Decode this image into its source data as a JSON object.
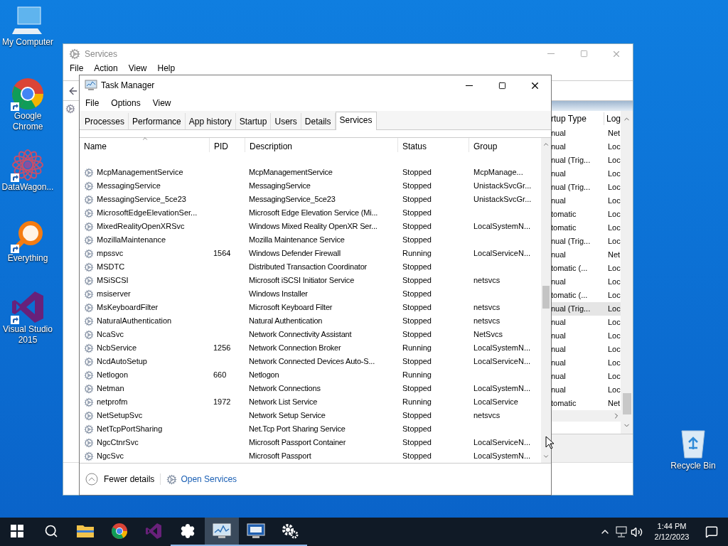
{
  "desktop_icons": [
    {
      "kind": "computer",
      "label": "My Computer",
      "shortcut": false
    },
    {
      "kind": "chrome",
      "label": "Google Chrome",
      "shortcut": true
    },
    {
      "kind": "datawagon",
      "label": "DataWagon...",
      "shortcut": true
    },
    {
      "kind": "everything",
      "label": "Everything",
      "shortcut": true
    },
    {
      "kind": "visual-studio",
      "label": "Visual Studio 2015",
      "shortcut": true
    }
  ],
  "recycle_bin": {
    "label": "Recycle Bin"
  },
  "services_window": {
    "title": "Services",
    "menu": [
      "File",
      "Action",
      "View",
      "Help"
    ],
    "columns": [
      "rtup Type",
      "Log"
    ],
    "rows": [
      {
        "startup_type": "nual",
        "log_on_as": "Net",
        "selected": false
      },
      {
        "startup_type": "nual",
        "log_on_as": "Loc",
        "selected": false
      },
      {
        "startup_type": "nual (Trig...",
        "log_on_as": "Loc",
        "selected": false
      },
      {
        "startup_type": "nual",
        "log_on_as": "Loc",
        "selected": false
      },
      {
        "startup_type": "nual (Trig...",
        "log_on_as": "Loc",
        "selected": false
      },
      {
        "startup_type": "nual",
        "log_on_as": "Loc",
        "selected": false
      },
      {
        "startup_type": "tomatic",
        "log_on_as": "Loc",
        "selected": false
      },
      {
        "startup_type": "tomatic",
        "log_on_as": "Loc",
        "selected": false
      },
      {
        "startup_type": "nual (Trig...",
        "log_on_as": "Loc",
        "selected": false
      },
      {
        "startup_type": "nual",
        "log_on_as": "Net",
        "selected": false
      },
      {
        "startup_type": "tomatic (...",
        "log_on_as": "Loc",
        "selected": false
      },
      {
        "startup_type": "nual",
        "log_on_as": "Loc",
        "selected": false
      },
      {
        "startup_type": "tomatic (...",
        "log_on_as": "Loc",
        "selected": false
      },
      {
        "startup_type": "nual (Trig...",
        "log_on_as": "Loc",
        "selected": true
      },
      {
        "startup_type": "nual",
        "log_on_as": "Loc",
        "selected": false
      },
      {
        "startup_type": "nual",
        "log_on_as": "Loc",
        "selected": false
      },
      {
        "startup_type": "nual",
        "log_on_as": "Loc",
        "selected": false
      },
      {
        "startup_type": "nual",
        "log_on_as": "Loc",
        "selected": false
      },
      {
        "startup_type": "nual",
        "log_on_as": "Loc",
        "selected": false
      },
      {
        "startup_type": "nual",
        "log_on_as": "Loc",
        "selected": false
      },
      {
        "startup_type": "tomatic",
        "log_on_as": "Net",
        "selected": false
      }
    ]
  },
  "task_manager": {
    "title": "Task Manager",
    "menu": [
      "File",
      "Options",
      "View"
    ],
    "tabs": [
      {
        "label": "Processes",
        "selected": false
      },
      {
        "label": "Performance",
        "selected": false
      },
      {
        "label": "App history",
        "selected": false
      },
      {
        "label": "Startup",
        "selected": false
      },
      {
        "label": "Users",
        "selected": false
      },
      {
        "label": "Details",
        "selected": false
      },
      {
        "label": "Services",
        "selected": true
      }
    ],
    "columns": [
      "Name",
      "PID",
      "Description",
      "Status",
      "Group"
    ],
    "rows": [
      {
        "name": "McpManagementService",
        "pid": "",
        "description": "McpManagementService",
        "status": "Stopped",
        "group": "McpManage..."
      },
      {
        "name": "MessagingService",
        "pid": "",
        "description": "MessagingService",
        "status": "Stopped",
        "group": "UnistackSvcGr..."
      },
      {
        "name": "MessagingService_5ce23",
        "pid": "",
        "description": "MessagingService_5ce23",
        "status": "Stopped",
        "group": "UnistackSvcGr..."
      },
      {
        "name": "MicrosoftEdgeElevationSer...",
        "pid": "",
        "description": "Microsoft Edge Elevation Service (Mi...",
        "status": "Stopped",
        "group": ""
      },
      {
        "name": "MixedRealityOpenXRSvc",
        "pid": "",
        "description": "Windows Mixed Reality OpenXR Ser...",
        "status": "Stopped",
        "group": "LocalSystemN..."
      },
      {
        "name": "MozillaMaintenance",
        "pid": "",
        "description": "Mozilla Maintenance Service",
        "status": "Stopped",
        "group": ""
      },
      {
        "name": "mpssvc",
        "pid": "1564",
        "description": "Windows Defender Firewall",
        "status": "Running",
        "group": "LocalServiceN..."
      },
      {
        "name": "MSDTC",
        "pid": "",
        "description": "Distributed Transaction Coordinator",
        "status": "Stopped",
        "group": ""
      },
      {
        "name": "MSiSCSI",
        "pid": "",
        "description": "Microsoft iSCSI Initiator Service",
        "status": "Stopped",
        "group": "netsvcs"
      },
      {
        "name": "msiserver",
        "pid": "",
        "description": "Windows Installer",
        "status": "Stopped",
        "group": ""
      },
      {
        "name": "MsKeyboardFilter",
        "pid": "",
        "description": "Microsoft Keyboard Filter",
        "status": "Stopped",
        "group": "netsvcs"
      },
      {
        "name": "NaturalAuthentication",
        "pid": "",
        "description": "Natural Authentication",
        "status": "Stopped",
        "group": "netsvcs"
      },
      {
        "name": "NcaSvc",
        "pid": "",
        "description": "Network Connectivity Assistant",
        "status": "Stopped",
        "group": "NetSvcs"
      },
      {
        "name": "NcbService",
        "pid": "1256",
        "description": "Network Connection Broker",
        "status": "Running",
        "group": "LocalSystemN..."
      },
      {
        "name": "NcdAutoSetup",
        "pid": "",
        "description": "Network Connected Devices Auto-S...",
        "status": "Stopped",
        "group": "LocalServiceN..."
      },
      {
        "name": "Netlogon",
        "pid": "660",
        "description": "Netlogon",
        "status": "Running",
        "group": ""
      },
      {
        "name": "Netman",
        "pid": "",
        "description": "Network Connections",
        "status": "Stopped",
        "group": "LocalSystemN..."
      },
      {
        "name": "netprofm",
        "pid": "1972",
        "description": "Network List Service",
        "status": "Running",
        "group": "LocalService"
      },
      {
        "name": "NetSetupSvc",
        "pid": "",
        "description": "Network Setup Service",
        "status": "Stopped",
        "group": "netsvcs"
      },
      {
        "name": "NetTcpPortSharing",
        "pid": "",
        "description": "Net.Tcp Port Sharing Service",
        "status": "Stopped",
        "group": ""
      },
      {
        "name": "NgcCtnrSvc",
        "pid": "",
        "description": "Microsoft Passport Container",
        "status": "Stopped",
        "group": "LocalServiceN..."
      },
      {
        "name": "NgcSvc",
        "pid": "",
        "description": "Microsoft Passport",
        "status": "Stopped",
        "group": "LocalSystemN..."
      }
    ],
    "footer": {
      "fewer_details": "Fewer details",
      "open_services": "Open Services"
    }
  },
  "taskbar": {
    "items": [
      {
        "kind": "start",
        "running": false,
        "active": false
      },
      {
        "kind": "search",
        "running": false,
        "active": false
      },
      {
        "kind": "folder",
        "running": false,
        "active": false
      },
      {
        "kind": "chrome",
        "running": false,
        "active": false
      },
      {
        "kind": "visual-studio",
        "running": false,
        "active": false
      },
      {
        "kind": "settings",
        "running": true,
        "active": false
      },
      {
        "kind": "task-manager",
        "running": true,
        "active": true
      },
      {
        "kind": "remote-desktop",
        "running": true,
        "active": false
      },
      {
        "kind": "services",
        "running": true,
        "active": false
      }
    ],
    "time": "1:44 PM",
    "date": "2/12/2023"
  }
}
